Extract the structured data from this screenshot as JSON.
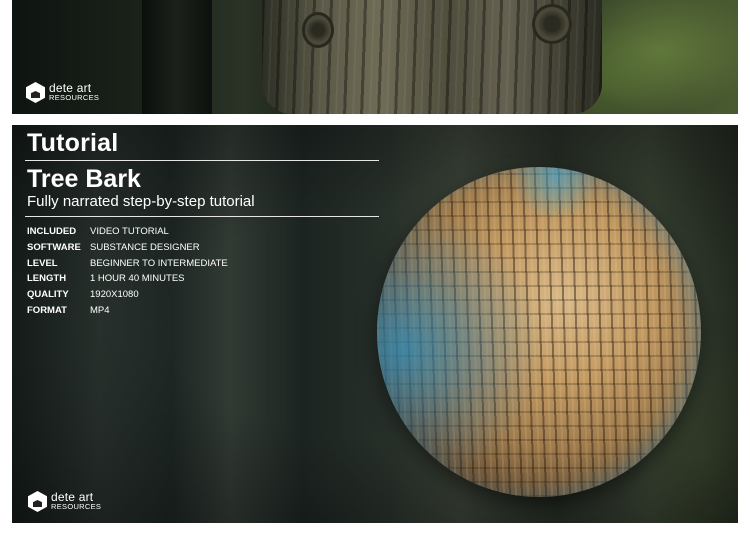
{
  "logo": {
    "name": "dete art",
    "sub": "RESOURCES"
  },
  "heading": {
    "label": "Tutorial",
    "title": "Tree Bark",
    "subtitle": "Fully narrated step-by-step tutorial"
  },
  "info": [
    {
      "key": "INCLUDED",
      "value": "VIDEO TUTORIAL"
    },
    {
      "key": "SOFTWARE",
      "value": "SUBSTANCE DESIGNER"
    },
    {
      "key": "LEVEL",
      "value": "BEGINNER TO INTERMEDIATE"
    },
    {
      "key": "LENGTH",
      "value": "1 HOUR 40 MINUTES"
    },
    {
      "key": "QUALITY",
      "value": "1920X1080"
    },
    {
      "key": "FORMAT",
      "value": "MP4"
    }
  ]
}
